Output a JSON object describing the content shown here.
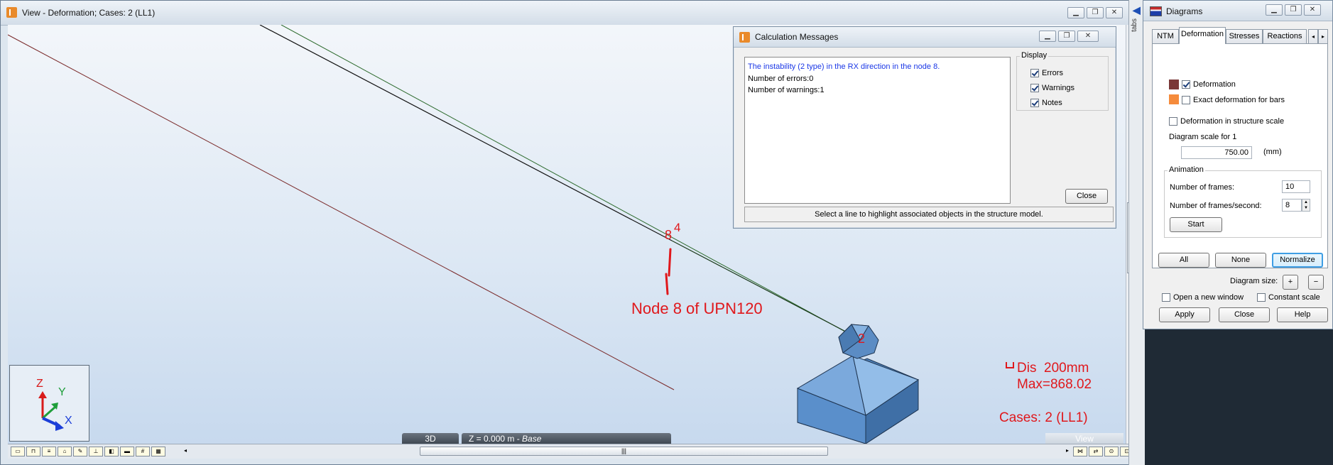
{
  "view_window": {
    "title": "View - Deformation; Cases: 2 (LL1)"
  },
  "viewport": {
    "annotation_node_label": "Node 8 of UPN120",
    "node_numbers": [
      "8",
      "4",
      "2"
    ],
    "legend": {
      "dis": "Dis  200mm",
      "max": "Max=868.02",
      "cases": "Cases: 2 (LL1)"
    },
    "axes": {
      "z": "Z",
      "y": "Y",
      "x": "X"
    }
  },
  "bottom_tabs": {
    "tab_3d": "3D",
    "tab_z_prefix": "Z = 0.000 m - ",
    "tab_z_italic": "Base",
    "view_label": "View"
  },
  "calc_messages": {
    "title": "Calculation Messages",
    "messages": [
      "The instability (2 type) in the RX direction in the node 8.",
      "Number of errors:0",
      "Number of warnings:1"
    ],
    "display_group": "Display",
    "display_options": [
      {
        "label": "Errors",
        "checked": true
      },
      {
        "label": "Warnings",
        "checked": true
      },
      {
        "label": "Notes",
        "checked": true
      }
    ],
    "close_label": "Close",
    "status": "Select a line to highlight associated objects in the structure model."
  },
  "tabs_strip": {
    "label": "tabs"
  },
  "diagrams": {
    "title": "Diagrams",
    "tabs": [
      "NTM",
      "Deformation",
      "Stresses",
      "Reactions"
    ],
    "active_tab": "Deformation",
    "deformation_label": "Deformation",
    "exact_label": "Exact deformation for bars",
    "structure_scale_label": "Deformation in structure scale",
    "diagram_scale_label": "Diagram scale for 1",
    "scale_value": "750.00",
    "scale_unit": "(mm)",
    "animation_group": "Animation",
    "frames_label": "Number of frames:",
    "frames_value": "10",
    "fps_label": "Number of frames/second:",
    "fps_value": "8",
    "start_label": "Start",
    "all_label": "All",
    "none_label": "None",
    "normalize_label": "Normalize",
    "diagram_size_label": "Diagram size:",
    "plus": "+",
    "minus": "−",
    "open_new_window_label": "Open a new window",
    "constant_scale_label": "Constant scale",
    "apply_label": "Apply",
    "close_label": "Close",
    "help_label": "Help",
    "colors": {
      "deformation": "#7a3838",
      "exact": "#f58b3c"
    }
  }
}
